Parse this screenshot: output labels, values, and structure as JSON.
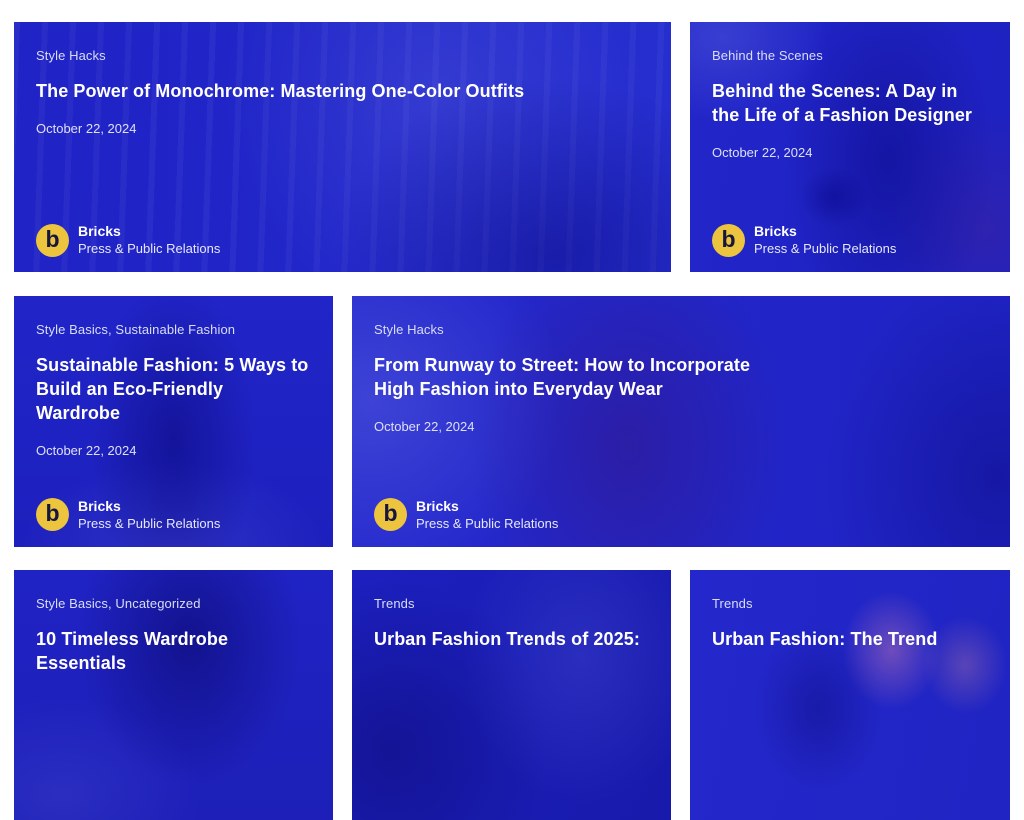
{
  "brand": {
    "name": "Bricks",
    "tagline": "Press & Public Relations",
    "logo_letter": "b",
    "logo_background": "#EDC43E",
    "logo_letter_color": "#17173E"
  },
  "colors": {
    "page_background": "#FFFFFF",
    "card_overlay_blue": "#2024C6",
    "title_text": "#FFFFFF",
    "muted_text": "#D9DDF5"
  },
  "cards": [
    {
      "category": "Style Hacks",
      "title_lines": [
        "The Power of Monochrome: Mastering One-Color Outfits"
      ],
      "date": "October 22, 2024"
    },
    {
      "category": "Behind the Scenes",
      "title_lines": [
        "Behind the Scenes: A Day in",
        "the Life of a Fashion Designer"
      ],
      "date": "October 22, 2024"
    },
    {
      "category": "Style Basics, Sustainable Fashion",
      "title_lines": [
        "Sustainable Fashion: 5 Ways to",
        "Build an Eco-Friendly Wardrobe"
      ],
      "date": "October 22, 2024"
    },
    {
      "category": "Style Hacks",
      "title_lines": [
        "From Runway to Street: How to Incorporate",
        "High Fashion into Everyday Wear"
      ],
      "date": "October 22, 2024"
    },
    {
      "category": "Style Basics, Uncategorized",
      "title_lines": [
        "10 Timeless Wardrobe Essentials"
      ]
    },
    {
      "category": "Trends",
      "title_lines": [
        "Urban Fashion Trends of 2025:"
      ]
    },
    {
      "category": "Trends",
      "title_lines": [
        "Urban Fashion: The Trend"
      ]
    }
  ]
}
